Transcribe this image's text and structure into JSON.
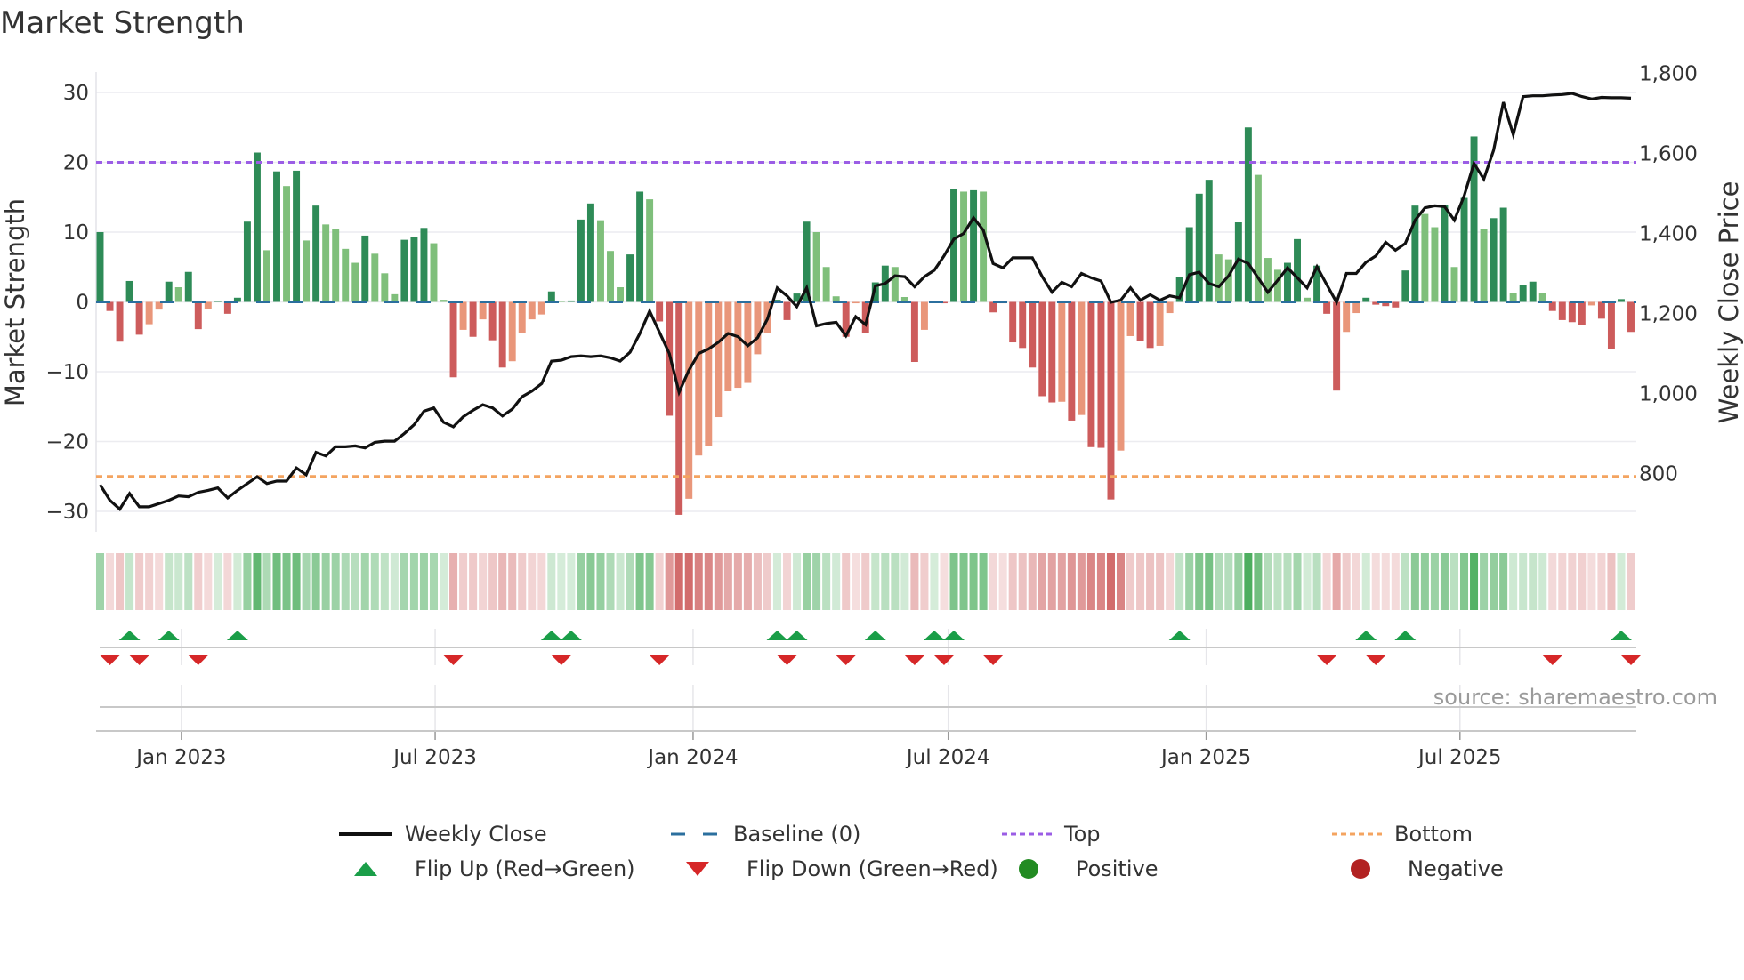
{
  "chart_data": {
    "type": "bar",
    "title": "Market Strength",
    "ylabel": "Market Strength",
    "y2label": "Weekly Close Price",
    "ylim": [
      -33,
      33
    ],
    "y2lim": [
      666,
      1850
    ],
    "yticks": [
      "30",
      "20",
      "10",
      "0",
      "−10",
      "−20",
      "−30"
    ],
    "ytick_values": [
      30,
      20,
      10,
      0,
      -10,
      -20,
      -30
    ],
    "y2ticks": [
      "1,800",
      "1,600",
      "1,400",
      "1,200",
      "1,000",
      "800"
    ],
    "y2tick_values": [
      1800,
      1600,
      1400,
      1200,
      1000,
      800
    ],
    "xticks": [
      "Jan 2023",
      "Jul 2023",
      "Jan 2024",
      "Jul 2024",
      "Jan 2025",
      "Jul 2025"
    ],
    "xtick_dates": [
      "2023-01-01",
      "2023-07-01",
      "2024-01-01",
      "2024-07-01",
      "2025-01-01",
      "2025-07-01"
    ],
    "start_date": "2022-11-04",
    "frequency": "weekly",
    "top_threshold": 20,
    "bottom_threshold": -25,
    "baseline": 0,
    "strength": [
      10,
      -1.3,
      -5.7,
      3,
      -4.7,
      -3.2,
      -1.1,
      2.9,
      2.1,
      4.3,
      -3.9,
      -1,
      0,
      -1.7,
      0.6,
      11.5,
      21.4,
      7.4,
      18.7,
      16.6,
      18.8,
      8.8,
      13.8,
      11.1,
      10.5,
      7.6,
      5.6,
      9.5,
      6.9,
      4.1,
      1.1,
      8.9,
      9.3,
      10.6,
      8.4,
      0.3,
      -10.8,
      -4,
      -5,
      -2.5,
      -5.5,
      -9.4,
      -8.5,
      -4.5,
      -2.5,
      -1.8,
      1.5,
      0,
      0.2,
      11.8,
      14.1,
      11.7,
      7.3,
      2.1,
      6.8,
      15.8,
      14.7,
      -2.8,
      -16.3,
      -30.5,
      -28.2,
      -22,
      -20.7,
      -16.5,
      -12.8,
      -12.3,
      -11.6,
      -7.5,
      -4.5,
      0.3,
      -2.6,
      1.2,
      11.5,
      10,
      5,
      0.8,
      -5,
      -0.2,
      -4.5,
      2.8,
      5.2,
      5,
      0.7,
      -8.6,
      -4,
      0,
      -0.2,
      16.2,
      15.8,
      16,
      15.8,
      -1.5,
      -0.2,
      -5.8,
      -6.6,
      -9.4,
      -13.5,
      -14.4,
      -14.3,
      -17,
      -16.2,
      -20.8,
      -20.9,
      -28.3,
      -21.3,
      -4.9,
      -5.6,
      -6.6,
      -6.3,
      -1.6,
      3.6,
      10.7,
      15.5,
      17.5,
      6.8,
      6.1,
      11.4,
      25,
      18.2,
      6.3,
      4.6,
      5.6,
      9,
      0.6,
      5.2,
      -1.7,
      -12.7,
      -4.3,
      -1.6,
      0.6,
      -0.4,
      -0.6,
      -0.8,
      4.5,
      13.8,
      12.6,
      10.7,
      13.9,
      5,
      14.9,
      23.7,
      10.4,
      12,
      13.5,
      1.3,
      2.4,
      2.9,
      1.3,
      -1.3,
      -2.6,
      -2.9,
      -3.3,
      -0.5,
      -2.4,
      -6.8,
      0.4,
      -4.3
    ],
    "weekly_close": [
      772,
      733,
      711,
      750,
      717,
      717,
      725,
      733,
      744,
      742,
      753,
      758,
      764,
      739,
      758,
      775,
      792,
      775,
      781,
      781,
      814,
      797,
      853,
      844,
      867,
      867,
      869,
      864,
      878,
      881,
      881,
      900,
      922,
      956,
      964,
      928,
      917,
      942,
      958,
      972,
      964,
      944,
      961,
      992,
      1006,
      1025,
      1081,
      1083,
      1092,
      1094,
      1092,
      1094,
      1089,
      1081,
      1103,
      1150,
      1206,
      1153,
      1100,
      1003,
      1058,
      1100,
      1111,
      1128,
      1150,
      1142,
      1119,
      1139,
      1186,
      1264,
      1244,
      1217,
      1264,
      1169,
      1175,
      1178,
      1144,
      1192,
      1172,
      1269,
      1275,
      1294,
      1292,
      1267,
      1292,
      1308,
      1344,
      1386,
      1400,
      1439,
      1408,
      1325,
      1314,
      1339,
      1339,
      1339,
      1292,
      1253,
      1278,
      1267,
      1300,
      1289,
      1281,
      1228,
      1233,
      1264,
      1233,
      1247,
      1233,
      1244,
      1239,
      1297,
      1303,
      1275,
      1267,
      1294,
      1336,
      1325,
      1289,
      1253,
      1283,
      1314,
      1289,
      1264,
      1317,
      1272,
      1228,
      1300,
      1300,
      1328,
      1344,
      1378,
      1358,
      1375,
      1433,
      1464,
      1469,
      1467,
      1433,
      1494,
      1575,
      1536,
      1608,
      1728,
      1647,
      1742,
      1744,
      1744,
      1746,
      1747,
      1750,
      1742,
      1736,
      1740,
      1739,
      1739,
      1738
    ],
    "flip_up_weeks": [
      3,
      7,
      14,
      46,
      48,
      69,
      71,
      79,
      85,
      87,
      110,
      129,
      133,
      155
    ],
    "flip_down_weeks": [
      1,
      4,
      10,
      36,
      47,
      57,
      70,
      76,
      83,
      86,
      91,
      125,
      130,
      148,
      156
    ],
    "legend": {
      "weekly_close": "Weekly Close",
      "baseline": "Baseline (0)",
      "top": "Top",
      "bottom": "Bottom",
      "flip_up": "Flip Up (Red→Green)",
      "flip_down": "Flip Down (Green→Red)",
      "positive": "Positive",
      "negative": "Negative"
    },
    "legend_placement": "bottom",
    "colors": {
      "pos_strong": "#2e8b57",
      "pos_weak": "#7fbf7b",
      "neg_strong": "#cd5c5c",
      "neg_weak": "#e9967a",
      "line": "#111111",
      "baseline": "#2b6f9e",
      "top": "#9b5de5",
      "bottom": "#f4a460",
      "flip_up": "#1a9e48",
      "flip_down": "#d62728",
      "positive": "#228b22",
      "negative": "#b22222"
    }
  },
  "source": "source: sharemaestro.com"
}
